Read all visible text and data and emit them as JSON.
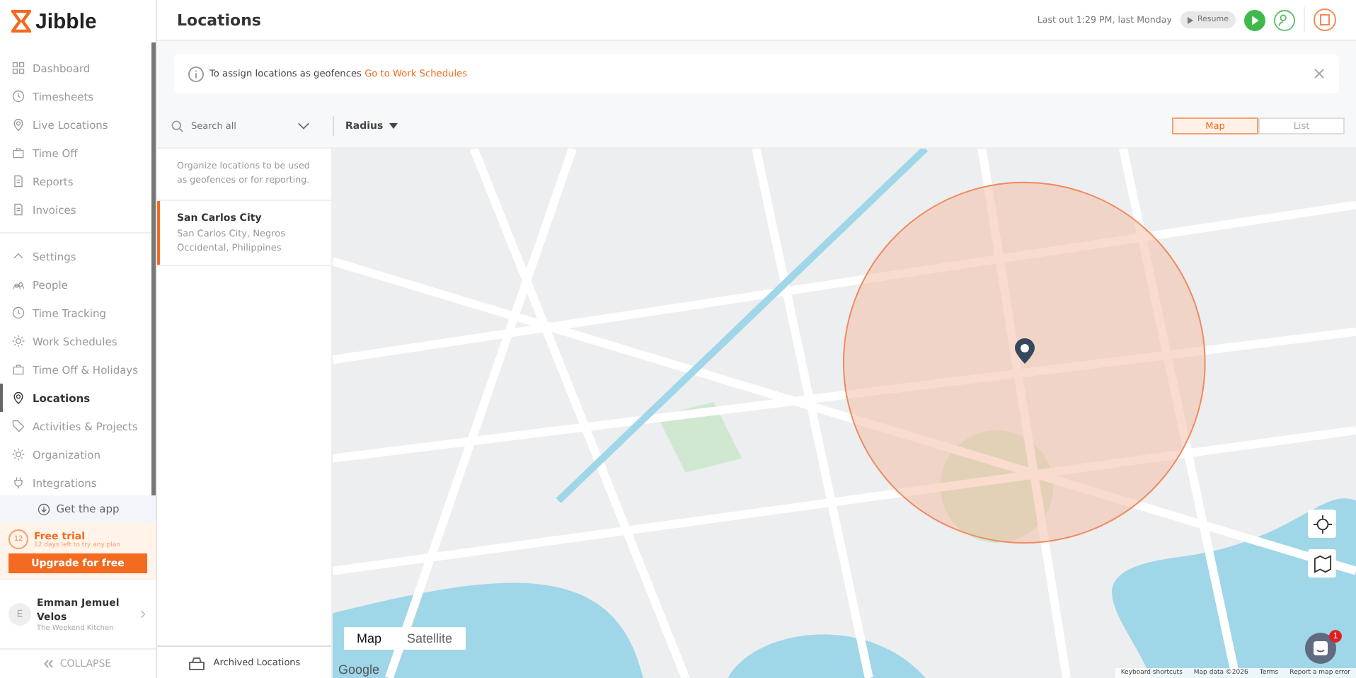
{
  "brand": "Jibble",
  "nav": [
    {
      "label": "Dashboard",
      "selected": false
    },
    {
      "label": "Timesheets",
      "selected": false
    },
    {
      "label": "Live Locations",
      "selected": false
    },
    {
      "label": "Time Off",
      "selected": false
    },
    {
      "label": "Reports",
      "selected": false
    },
    {
      "label": "Invoices",
      "selected": false
    }
  ],
  "settings": {
    "label": "Settings",
    "expanded": true,
    "items": [
      {
        "label": "People",
        "selected": false
      },
      {
        "label": "Time Tracking",
        "selected": false
      },
      {
        "label": "Work Schedules",
        "selected": false
      },
      {
        "label": "Time Off & Holidays",
        "selected": false
      },
      {
        "label": "Locations",
        "selected": true
      },
      {
        "label": "Activities & Projects",
        "selected": false
      },
      {
        "label": "Organization",
        "selected": false
      },
      {
        "label": "Integrations",
        "selected": false
      }
    ]
  },
  "get_app": "Get the app",
  "trial": {
    "badge": "12",
    "title": "Free trial",
    "subtitle": "12 days left to try any plan",
    "button": "Upgrade for free"
  },
  "user": {
    "initial": "E",
    "name": "Emman Jemuel Velos",
    "org": "The Weekend Kitchen"
  },
  "collapse": "COLLAPSE",
  "page_title": "Locations",
  "last_out": "Last out 1:29 PM, last Monday",
  "resume": "Resume",
  "banner": {
    "text": "To assign locations as geofences",
    "link": "Go to Work Schedules"
  },
  "search": {
    "placeholder": "Search all"
  },
  "radius": "Radius",
  "views": [
    {
      "label": "Map",
      "selected": true
    },
    {
      "label": "List",
      "selected": false
    }
  ],
  "hint": "Organize locations to be used as geofences or for reporting.",
  "locations": [
    {
      "name": "San Carlos City",
      "address": "San Carlos City, Negros Occidental, Philippines",
      "selected": true
    }
  ],
  "archived": "Archived Locations",
  "map_types": [
    {
      "label": "Map",
      "selected": true
    },
    {
      "label": "Satellite",
      "selected": false
    }
  ],
  "map_footer": [
    "Keyboard shortcuts",
    "Map data ©2026",
    "Terms",
    "Report a map error"
  ],
  "google": "Google",
  "chat_badge": "1"
}
